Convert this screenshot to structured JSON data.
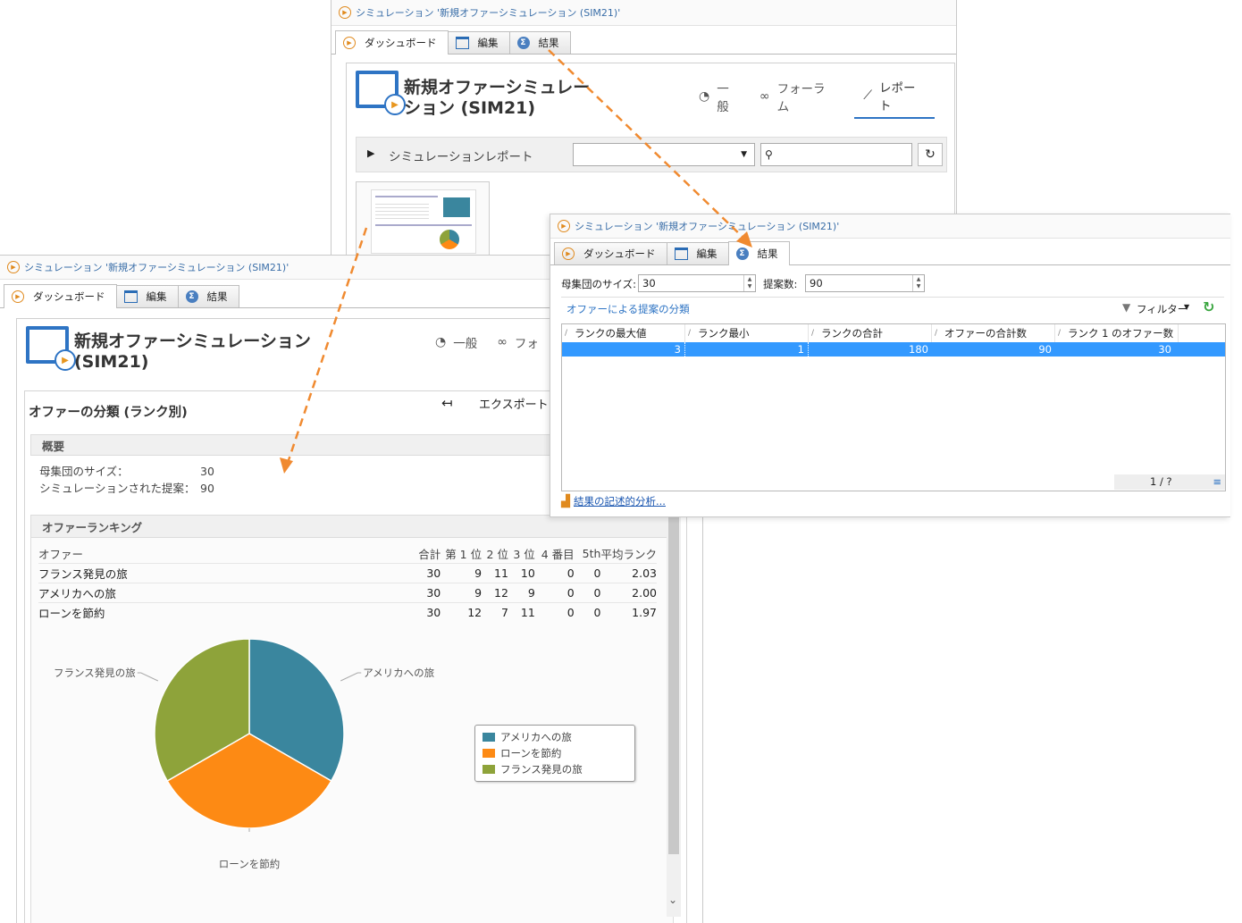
{
  "window_title": "シミュレーション '新規オファーシミュレーション (SIM21)'",
  "tabs": {
    "dashboard": "ダッシュボード",
    "edit": "編集",
    "results": "結果"
  },
  "top": {
    "heading": "新規オファーシミュレー\nション (SIM21)",
    "nav": {
      "general": "一般",
      "forum": "フォーラム",
      "report": "レポート"
    },
    "report_row_label": "シミュレーションレポート",
    "dropdown_value": "",
    "search_value": ""
  },
  "left": {
    "heading_line1": "新規オファーシミュレーション",
    "heading_line2": "(SIM21)",
    "nav": {
      "general": "一般",
      "forum": "フォ"
    },
    "report_title": "オファーの分類 (ランク別)",
    "export_label": "エクスポート",
    "summary": {
      "title": "概要",
      "rows": [
        {
          "label": "母集団のサイズ：",
          "value": "30"
        },
        {
          "label": "シミュレーションされた提案：",
          "value": "90"
        }
      ]
    },
    "ranking": {
      "title": "オファーランキング",
      "headers": [
        "オファー",
        "合計",
        "第 1 位",
        "2 位",
        "3 位",
        "4 番目",
        "5th",
        "平均ランク"
      ],
      "rows": [
        [
          "フランス発見の旅",
          "30",
          "9",
          "11",
          "10",
          "0",
          "0",
          "2.03"
        ],
        [
          "アメリカへの旅",
          "30",
          "9",
          "12",
          "9",
          "0",
          "0",
          "2.00"
        ],
        [
          "ローンを節約",
          "30",
          "12",
          "7",
          "11",
          "0",
          "0",
          "1.97"
        ]
      ]
    }
  },
  "chart_data": {
    "type": "pie",
    "categories": [
      "アメリカへの旅",
      "ローンを節約",
      "フランス発見の旅"
    ],
    "values": [
      30,
      30,
      30
    ],
    "colors": [
      "#3a869e",
      "#fd8a14",
      "#8ea33a"
    ],
    "legend": "right"
  },
  "right": {
    "population_label": "母集団のサイズ:",
    "population_value": "30",
    "proposals_label": "提案数:",
    "proposals_value": "90",
    "section_link": "オファーによる提案の分類",
    "filter_label": "フィルター",
    "grid_headers": [
      "ランクの最大値",
      "ランク最小",
      "ランクの合計",
      "オファーの合計数",
      "ランク 1 のオファー数"
    ],
    "grid_row": [
      "3",
      "1",
      "180",
      "90",
      "30"
    ],
    "pager": "1 / ?",
    "analysis_link": "結果の記述的分析..."
  },
  "colors": {
    "accent": "#2e74c4",
    "selection": "#3399ff",
    "arrow": "#f08a30"
  }
}
